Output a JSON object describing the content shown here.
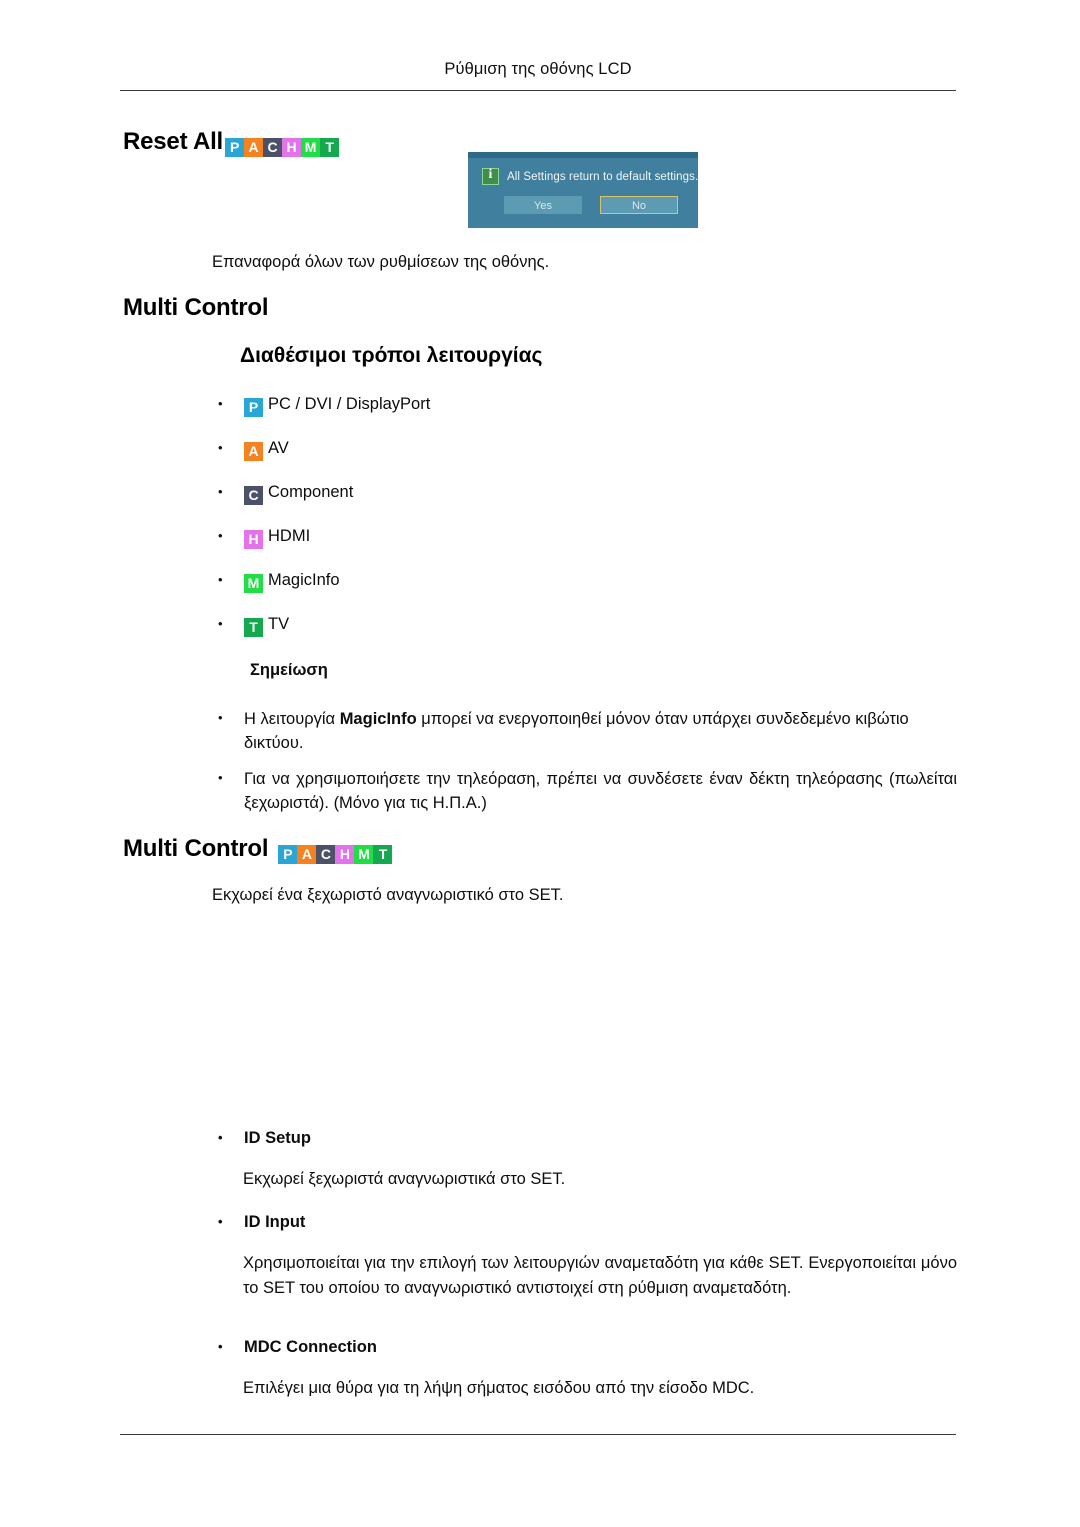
{
  "page": {
    "running_header": "Ρύθμιση της οθόνης LCD"
  },
  "mode_badges": {
    "legend": [
      {
        "key": "P",
        "letter": "P",
        "color": "#29a6d6",
        "label": "PC / DVI / DisplayPort"
      },
      {
        "key": "A",
        "letter": "A",
        "color": "#f58220",
        "label": "AV"
      },
      {
        "key": "C",
        "letter": "C",
        "color": "#4b5166",
        "label": "Component"
      },
      {
        "key": "H",
        "letter": "H",
        "color": "#e273ea",
        "label": "HDMI"
      },
      {
        "key": "M",
        "letter": "M",
        "color": "#21dd46",
        "label": "MagicInfo"
      },
      {
        "key": "T",
        "letter": "T",
        "color": "#14a94e",
        "label": "TV"
      }
    ]
  },
  "reset_all": {
    "title": "Reset All",
    "badges": [
      "P",
      "A",
      "C",
      "H",
      "M",
      "T"
    ],
    "description": "Επαναφορά όλων των ρυθμίσεων της οθόνης.",
    "osd_dialog": {
      "message": "All Settings return to default settings.",
      "info_icon": "info-icon",
      "buttons": [
        {
          "label": "Yes",
          "selected": false
        },
        {
          "label": "No",
          "selected": true
        }
      ]
    }
  },
  "multi_control_section": {
    "title": "Multi Control",
    "available_modes_heading": "Διαθέσιμοι τρόποι λειτουργίας",
    "mode_items": [
      {
        "badge": "P",
        "label": "PC / DVI / DisplayPort"
      },
      {
        "badge": "A",
        "label": "AV"
      },
      {
        "badge": "C",
        "label": "Component"
      },
      {
        "badge": "H",
        "label": "HDMI"
      },
      {
        "badge": "M",
        "label": "MagicInfo"
      },
      {
        "badge": "T",
        "label": "TV"
      }
    ],
    "note_label": "Σημείωση",
    "notes": [
      {
        "text_before": "Η λειτουργία ",
        "bold": "MagicInfo",
        "text_after": " μπορεί να ενεργοποιηθεί μόνον όταν υπάρχει συνδεδεμένο κιβώτιο δικτύου."
      },
      {
        "text_before": "Για να χρησιμοποιήσετε την τηλεόραση, πρέπει να συνδέσετε έναν δέκτη τηλεόρασης (πωλείται ξεχωριστά). (Μόνο για τις Η.Π.Α.)",
        "bold": "",
        "text_after": ""
      }
    ]
  },
  "multi_control_detail": {
    "title": "Multi Control",
    "badges": [
      "P",
      "A",
      "C",
      "H",
      "M",
      "T"
    ],
    "description": "Εκχωρεί ένα ξεχωριστό αναγνωριστικό στο SET.",
    "items": [
      {
        "label": "ID Setup",
        "body": "Εκχωρεί ξεχωριστά αναγνωριστικά στο SET."
      },
      {
        "label": "ID Input",
        "body": "Χρησιμοποιείται για την επιλογή των λειτουργιών αναμεταδότη για κάθε SET. Ενεργοποιείται μόνο το SET του οποίου το αναγνωριστικό αντιστοιχεί στη ρύθμιση αναμεταδότη."
      },
      {
        "label": "MDC Connection",
        "body": "Επιλέγει μια θύρα για τη λήψη σήματος εισόδου από την είσοδο MDC."
      }
    ]
  }
}
